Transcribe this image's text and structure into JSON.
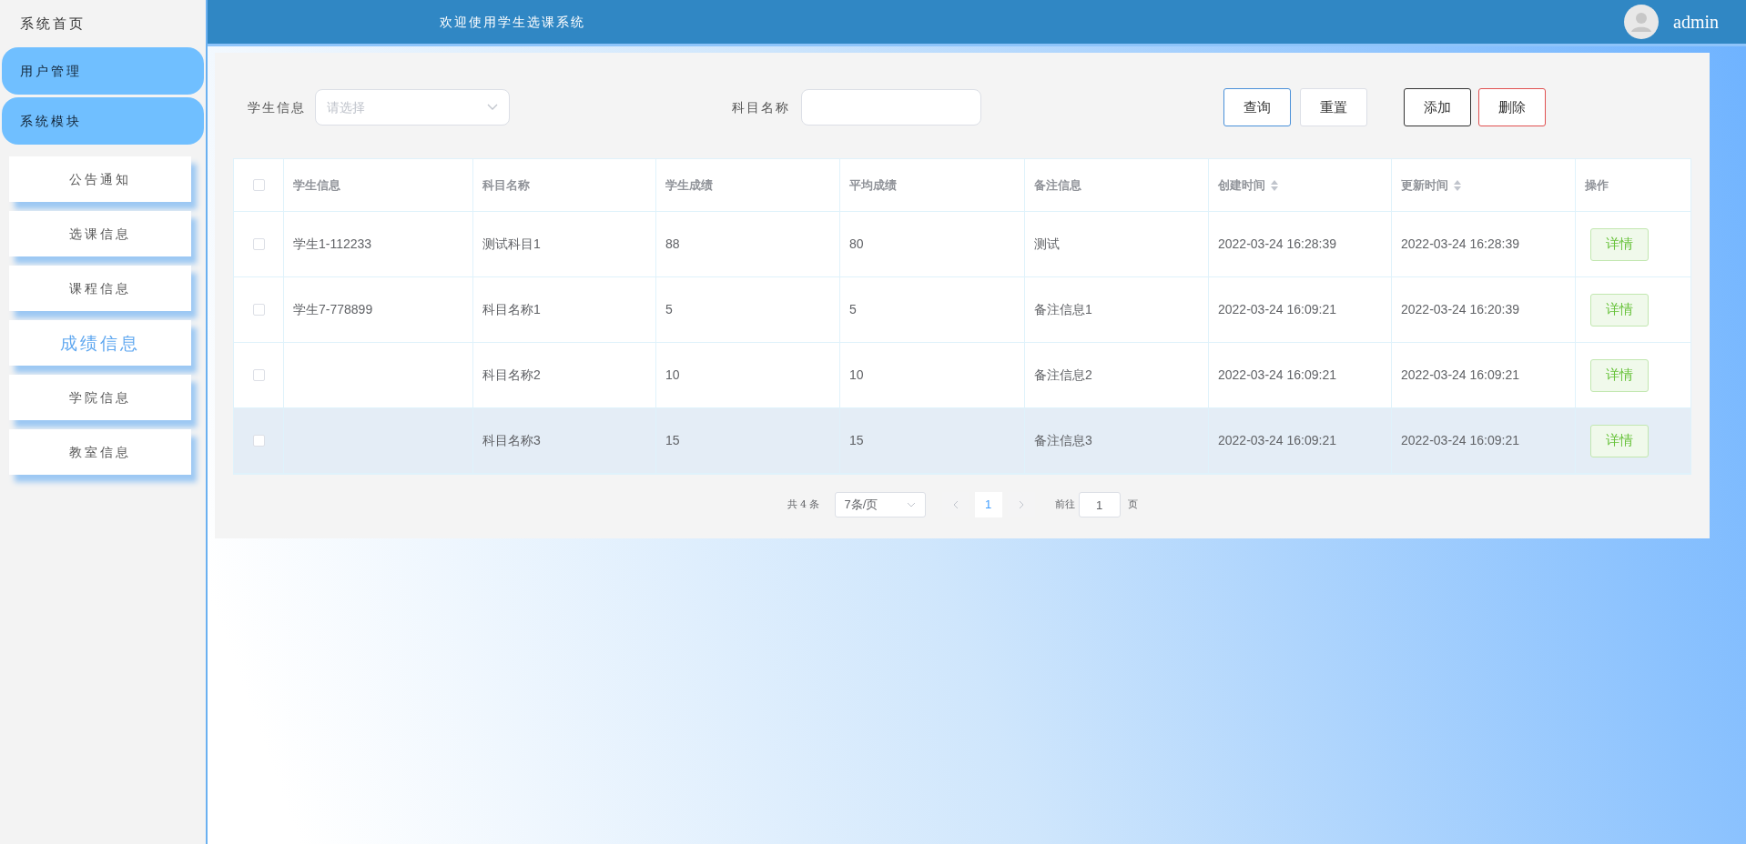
{
  "sidebar": {
    "home": "系统首页",
    "groups": [
      "用户管理",
      "系统模块"
    ],
    "items": [
      {
        "label": "公告通知",
        "selected": false
      },
      {
        "label": "选课信息",
        "selected": false
      },
      {
        "label": "课程信息",
        "selected": false
      },
      {
        "label": "成绩信息",
        "selected": true
      },
      {
        "label": "学院信息",
        "selected": false
      },
      {
        "label": "教室信息",
        "selected": false
      }
    ]
  },
  "header": {
    "title": "欢迎使用学生选课系统",
    "user": "admin"
  },
  "filters": {
    "student_label": "学生信息",
    "student_placeholder": "请选择",
    "subject_label": "科目名称",
    "buttons": [
      {
        "label": "查询",
        "kind": "primary"
      },
      {
        "label": "重置",
        "kind": "plain"
      },
      {
        "label": "添加",
        "kind": "dark"
      },
      {
        "label": "删除",
        "kind": "danger"
      }
    ]
  },
  "table": {
    "select_all_checked": false,
    "columns": [
      {
        "label": "学生信息",
        "sortable": false
      },
      {
        "label": "科目名称",
        "sortable": false
      },
      {
        "label": "学生成绩",
        "sortable": false
      },
      {
        "label": "平均成绩",
        "sortable": false
      },
      {
        "label": "备注信息",
        "sortable": false
      },
      {
        "label": "创建时间",
        "sortable": true
      },
      {
        "label": "更新时间",
        "sortable": true
      },
      {
        "label": "操作",
        "sortable": false
      }
    ],
    "rows": [
      {
        "checked": false,
        "hovered": false,
        "cells": [
          "学生1-112233",
          "测试科目1",
          "88",
          "80",
          "测试",
          "2022-03-24 16:28:39",
          "2022-03-24 16:28:39"
        ],
        "action": "详情"
      },
      {
        "checked": false,
        "hovered": false,
        "cells": [
          "学生7-778899",
          "科目名称1",
          "5",
          "5",
          "备注信息1",
          "2022-03-24 16:09:21",
          "2022-03-24 16:20:39"
        ],
        "action": "详情"
      },
      {
        "checked": false,
        "hovered": false,
        "cells": [
          "",
          "科目名称2",
          "10",
          "10",
          "备注信息2",
          "2022-03-24 16:09:21",
          "2022-03-24 16:09:21"
        ],
        "action": "详情"
      },
      {
        "checked": false,
        "hovered": true,
        "cells": [
          "",
          "科目名称3",
          "15",
          "15",
          "备注信息3",
          "2022-03-24 16:09:21",
          "2022-03-24 16:09:21"
        ],
        "action": "详情"
      }
    ]
  },
  "pagination": {
    "total": "共 4 条",
    "page_size": "7条/页",
    "pages": [
      {
        "label": "1",
        "selected": true
      }
    ],
    "goto_label": "前往",
    "goto_value": "1",
    "goto_suffix": "页"
  }
}
